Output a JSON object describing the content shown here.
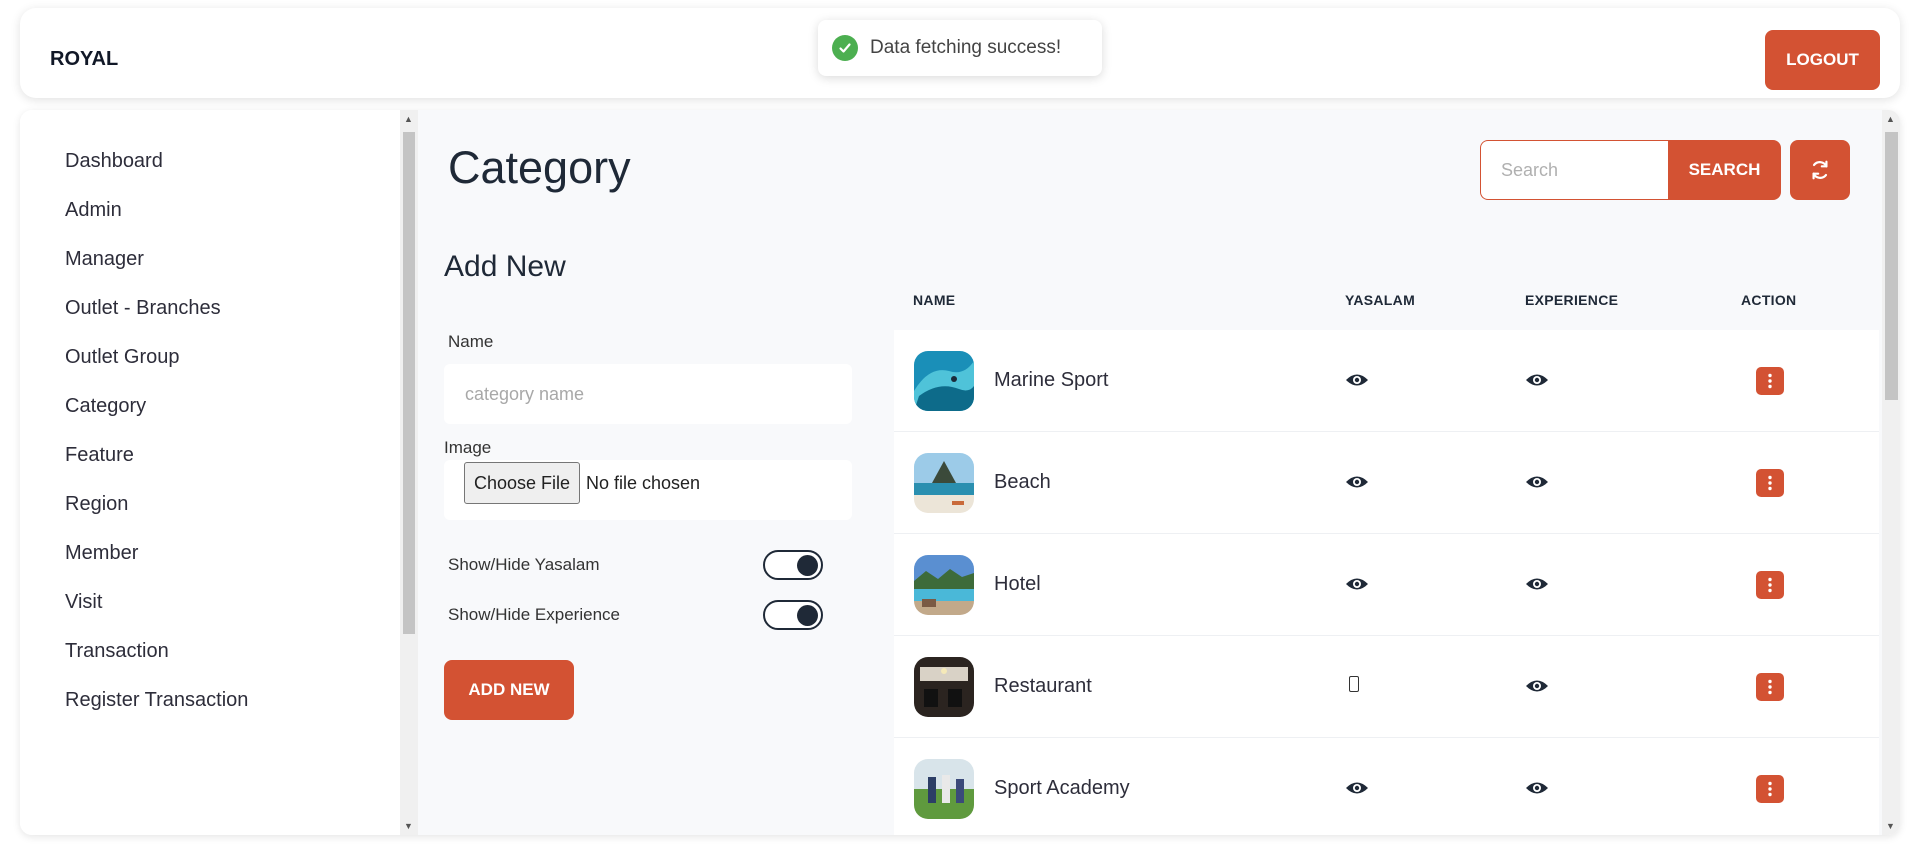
{
  "header": {
    "brand": "ROYAL",
    "logout_label": "LOGOUT"
  },
  "toast": {
    "message": "Data fetching success!",
    "icon": "check-circle-icon",
    "color": "#4caf50"
  },
  "sidebar": {
    "items": [
      {
        "label": "Dashboard"
      },
      {
        "label": "Admin"
      },
      {
        "label": "Manager"
      },
      {
        "label": "Outlet - Branches"
      },
      {
        "label": "Outlet Group"
      },
      {
        "label": "Category"
      },
      {
        "label": "Feature"
      },
      {
        "label": "Region"
      },
      {
        "label": "Member"
      },
      {
        "label": "Visit"
      },
      {
        "label": "Transaction"
      },
      {
        "label": "Register Transaction"
      }
    ]
  },
  "page": {
    "title": "Category",
    "search": {
      "placeholder": "Search",
      "button_label": "SEARCH",
      "refresh_icon": "refresh-icon"
    }
  },
  "form": {
    "title": "Add New",
    "name_label": "Name",
    "name_placeholder": "category name",
    "image_label": "Image",
    "file_button": "Choose File",
    "file_status": "No file chosen",
    "toggle_yasalam_label": "Show/Hide Yasalam",
    "toggle_experience_label": "Show/Hide Experience",
    "toggle_yasalam_on": true,
    "toggle_experience_on": true,
    "submit_label": "ADD NEW"
  },
  "table": {
    "columns": [
      "NAME",
      "YASALAM",
      "EXPERIENCE",
      "ACTION"
    ],
    "rows": [
      {
        "name": "Marine Sport",
        "yasalam": "eye-icon",
        "experience": "eye-icon"
      },
      {
        "name": "Beach",
        "yasalam": "eye-icon",
        "experience": "eye-icon"
      },
      {
        "name": "Hotel",
        "yasalam": "eye-icon",
        "experience": "eye-icon"
      },
      {
        "name": "Restaurant",
        "yasalam": "missing-glyph-icon",
        "experience": "eye-icon"
      },
      {
        "name": "Sport Academy",
        "yasalam": "eye-icon",
        "experience": "eye-icon"
      }
    ]
  },
  "colors": {
    "accent": "#d35233",
    "text_dark": "#1f2937",
    "main_bg": "#f8f9fb"
  }
}
